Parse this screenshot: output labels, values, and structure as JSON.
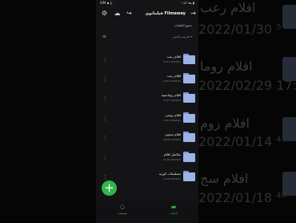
{
  "status_bar": {
    "left": "SIM ▪ 𝄞 ◦",
    "right": "١:٥٦ ▾▴ ▮"
  },
  "header": {
    "title": "فيلمانوي Filmaway",
    "back_icon": "arrow-right-icon",
    "actions": [
      "settings-icon",
      "upload-icon",
      "share-icon"
    ]
  },
  "breadcrumb": "جميع الملفات",
  "sort_label": "الترتيب بالاسم ▾",
  "folders": [
    {
      "name": "افلام رعب",
      "date": "14:11 2022/01"
    },
    {
      "name": "افلام رعب",
      "date": "14:11 2022/01"
    },
    {
      "name": "افلام رومانسية",
      "date": "17:17 2022/01"
    },
    {
      "name": "افلام زومبي",
      "date": "14:17 2022/01"
    },
    {
      "name": "افلام سجون",
      "date": "16:40 2022/01"
    },
    {
      "name": "سلاسل افلام",
      "date": "11:30 2022/01"
    },
    {
      "name": "مسلسلات كورية",
      "date": "13:45 2022/01"
    }
  ],
  "fab": {
    "label": "+"
  },
  "bottom_nav": [
    {
      "label": "مؤسسات",
      "icon": "chat-icon",
      "active": false
    },
    {
      "label": "الملفات",
      "icon": "folder-icon",
      "active": true
    }
  ],
  "background": {
    "left_texts": [],
    "right_names": [
      "افلام رعب",
      "افلام روما",
      "افلام زوم",
      "افلام سج"
    ],
    "right_times": [
      "2022/01/30 ⁵",
      "2022/02/29 17:⁰²",
      "2022/01/14 ⁴⁷",
      "2022/01/18 ⁴⁰"
    ]
  }
}
